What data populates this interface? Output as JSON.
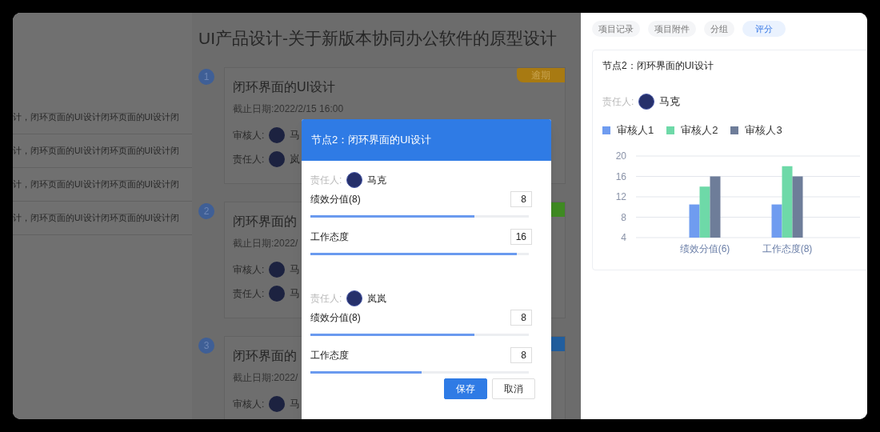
{
  "page_title": "UI产品设计-关于新版本协同办公软件的原型设计",
  "sidebar": {
    "items": [
      {
        "text": "计，闭环页面的UI设计闭环页面的UI设计闭"
      },
      {
        "text": "计，闭环页面的UI设计闭环页面的UI设计闭"
      },
      {
        "text": "计，闭环页面的UI设计闭环页面的UI设计闭"
      },
      {
        "text": "计，闭环页面的UI设计闭环页面的UI设计闭"
      }
    ]
  },
  "nodes": [
    {
      "step": "1",
      "title": "闭环界面的UI设计",
      "deadline": "截止日期:2022/2/15 16:00",
      "badge": {
        "text": "逾期",
        "color": "#a87a12"
      },
      "people": [
        {
          "label": "审核人:",
          "name": "马"
        },
        {
          "label": "责任人:",
          "name": "岚"
        }
      ]
    },
    {
      "step": "2",
      "title": "闭环界面的",
      "deadline": "截止日期:2022/",
      "badge": {
        "color": "#3f8a22"
      },
      "people": [
        {
          "label": "审核人:",
          "name": "马"
        },
        {
          "label": "责任人:",
          "name": "马"
        }
      ]
    },
    {
      "step": "3",
      "title": "闭环界面的",
      "deadline": "截止日期:2022/",
      "badge": {
        "color": "#215e9e"
      },
      "people": [
        {
          "label": "审核人:",
          "name": "马"
        }
      ]
    }
  ],
  "dialog": {
    "title": "节点2：闭环界面的UI设计",
    "groups": [
      {
        "label": "责任人:",
        "name": "马克",
        "scores": [
          {
            "label": "绩效分值(8)",
            "value": "8",
            "level": 0.75
          },
          {
            "label": "工作态度",
            "value": "16",
            "level": 0.945
          }
        ]
      },
      {
        "label": "责任人:",
        "name": "岚岚",
        "scores": [
          {
            "label": "绩效分值(8)",
            "value": "8",
            "level": 0.75
          },
          {
            "label": "工作态度",
            "value": "8",
            "level": 0.51
          }
        ]
      }
    ],
    "buttons": [
      {
        "label": "保存",
        "kind": "primary"
      },
      {
        "label": "取消",
        "kind": "secondary"
      }
    ]
  },
  "right_panel": {
    "tabs": [
      {
        "label": "项目记录",
        "selected": false
      },
      {
        "label": "项目附件",
        "selected": false
      },
      {
        "label": "分组",
        "selected": false
      },
      {
        "label": "评分",
        "selected": true
      }
    ],
    "card": {
      "title": "节点2：闭环界面的UI设计",
      "owner_label": "责任人:",
      "owner_name": "马克",
      "chart_data": {
        "type": "bar",
        "categories": [
          "绩效分值(6)",
          "工作态度(8)"
        ],
        "series": [
          {
            "name": "审核人1",
            "color": "#6f9cf0",
            "values": [
              10.5,
              10.5
            ]
          },
          {
            "name": "审核人2",
            "color": "#6ed9a8",
            "values": [
              14,
              18
            ]
          },
          {
            "name": "审核人3",
            "color": "#6e7d99",
            "values": [
              16,
              16
            ]
          }
        ],
        "ylim": [
          4,
          20
        ],
        "yticks": [
          4,
          8,
          12,
          16,
          20
        ],
        "grid": true,
        "legend": "top"
      }
    }
  }
}
